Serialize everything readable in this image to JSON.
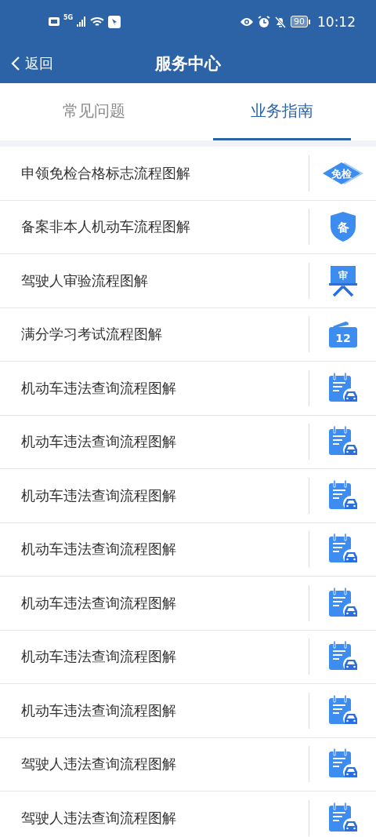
{
  "status_bar": {
    "network": "5G",
    "battery": "90",
    "time": "10:12"
  },
  "header": {
    "back": "返回",
    "title": "服务中心"
  },
  "tabs": [
    {
      "label": "常见问题",
      "selected": false
    },
    {
      "label": "业务指南",
      "selected": true
    }
  ],
  "guides": [
    {
      "title": "申领免检合格标志流程图解",
      "kind": "diamond",
      "icon_text": "免检"
    },
    {
      "title": "备案非本人机动车流程图解",
      "kind": "shield",
      "icon_text": "备"
    },
    {
      "title": "驾驶人审验流程图解",
      "kind": "board",
      "icon_text": "审"
    },
    {
      "title": "满分学习考试流程图解",
      "kind": "folder",
      "icon_text": "12"
    },
    {
      "title": "机动车违法查询流程图解",
      "kind": "notepad"
    },
    {
      "title": "机动车违法查询流程图解",
      "kind": "notepad"
    },
    {
      "title": "机动车违法查询流程图解",
      "kind": "notepad"
    },
    {
      "title": "机动车违法查询流程图解",
      "kind": "notepad"
    },
    {
      "title": "机动车违法查询流程图解",
      "kind": "notepad"
    },
    {
      "title": "机动车违法查询流程图解",
      "kind": "notepad"
    },
    {
      "title": "机动车违法查询流程图解",
      "kind": "notepad"
    },
    {
      "title": "驾驶人违法查询流程图解",
      "kind": "notepad"
    },
    {
      "title": "驾驶人违法查询流程图解",
      "kind": "notepad"
    }
  ]
}
